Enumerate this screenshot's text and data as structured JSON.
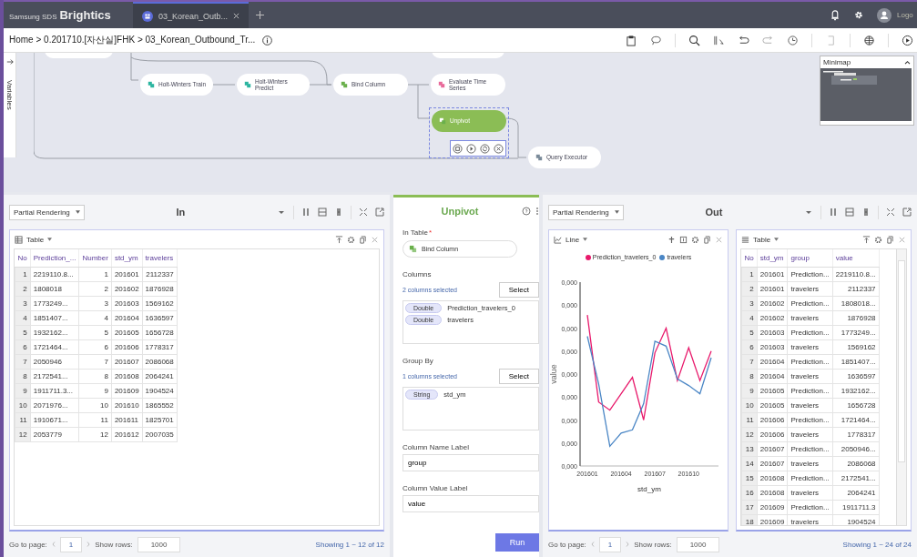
{
  "app": {
    "brand_prefix": "Samsung SDS",
    "brand": "Brightics",
    "tabs": [
      {
        "label": "03_Korean_Outb...",
        "selected": true
      }
    ],
    "user": "Logo"
  },
  "breadcrumb": "Home > 0.201710.[자산실]FHK > 03_Korean_Outbound_Tr...",
  "sidebar": {
    "label": "Variables"
  },
  "canvas": {
    "nodes": [
      {
        "label": "Holt-Winters Train",
        "kind": "model",
        "selected": false
      },
      {
        "label": "Holt-Winters Predict",
        "kind": "model",
        "selected": false
      },
      {
        "label": "Bind Column",
        "kind": "transform",
        "selected": false
      },
      {
        "label": "Evaluate Time Series",
        "kind": "evaluate",
        "selected": false
      },
      {
        "label": "Unpivot",
        "kind": "transform",
        "selected": true
      },
      {
        "label": "Query Executor",
        "kind": "script",
        "selected": false
      }
    ],
    "minimap": {
      "title": "Minimap"
    }
  },
  "input_panel": {
    "render_mode": "Partial Rendering",
    "title": "In",
    "table": {
      "title": "Table",
      "columns": [
        {
          "label": "No"
        },
        {
          "label": "Prediction_..."
        },
        {
          "label": "Number"
        },
        {
          "label": "std_ym"
        },
        {
          "label": "travelers"
        }
      ],
      "rows": [
        [
          "1",
          "2219110.8...",
          "1",
          "201601",
          "2112337"
        ],
        [
          "2",
          "1808018",
          "2",
          "201602",
          "1876928"
        ],
        [
          "3",
          "1773249...",
          "3",
          "201603",
          "1569162"
        ],
        [
          "4",
          "1851407...",
          "4",
          "201604",
          "1636597"
        ],
        [
          "5",
          "1932162...",
          "5",
          "201605",
          "1656728"
        ],
        [
          "6",
          "1721464...",
          "6",
          "201606",
          "1778317"
        ],
        [
          "7",
          "2050946",
          "7",
          "201607",
          "2086068"
        ],
        [
          "8",
          "2172541...",
          "8",
          "201608",
          "2064241"
        ],
        [
          "9",
          "1911711.3...",
          "9",
          "201609",
          "1904524"
        ],
        [
          "10",
          "2071976...",
          "10",
          "201610",
          "1865552"
        ],
        [
          "11",
          "1910671...",
          "11",
          "201611",
          "1825701"
        ],
        [
          "12",
          "2053779",
          "12",
          "201612",
          "2007035"
        ]
      ]
    },
    "footer": {
      "goto_label": "Go to page:",
      "page": "1",
      "rows_label": "Show rows:",
      "rows": "1000",
      "showing": "Showing 1 ~ 12 of 12"
    }
  },
  "editor": {
    "title": "Unpivot",
    "in_table": {
      "label": "In Table",
      "required_mark": "*",
      "value": "Bind Column"
    },
    "columns": {
      "label": "Columns",
      "count": "2 columns selected",
      "button": "Select",
      "items": [
        {
          "type": "Double",
          "name": "Prediction_travelers_0"
        },
        {
          "type": "Double",
          "name": "travelers"
        }
      ]
    },
    "group_by": {
      "label": "Group By",
      "count": "1 columns selected",
      "button": "Select",
      "items": [
        {
          "type": "String",
          "name": "std_ym"
        }
      ]
    },
    "name_label": {
      "label": "Column Name Label",
      "value": "group"
    },
    "value_label": {
      "label": "Column Value Label",
      "value": "value"
    },
    "run": "Run"
  },
  "output_panel": {
    "render_mode": "Partial Rendering",
    "title": "Out",
    "chart": {
      "title": "Line",
      "legend": [
        {
          "name": "Prediction_travelers_0",
          "color": "#e8196b"
        },
        {
          "name": "travelers",
          "color": "#4a86c5"
        }
      ],
      "x_labels": [
        "201601",
        "201604",
        "201607",
        "201610"
      ],
      "xlabel": "std_ym",
      "ylabel": "value",
      "y_axis_labels": [
        "0,000",
        "0,000",
        "0,000",
        "0,000",
        "0,000",
        "0,000",
        "0,000",
        "0,000",
        "0,000"
      ]
    },
    "table": {
      "title": "Table",
      "columns": [
        {
          "label": "No"
        },
        {
          "label": "std_ym"
        },
        {
          "label": "group"
        },
        {
          "label": "value"
        }
      ],
      "rows": [
        [
          "1",
          "201601",
          "Prediction...",
          "2219110.8..."
        ],
        [
          "2",
          "201601",
          "travelers",
          "2112337"
        ],
        [
          "3",
          "201602",
          "Prediction...",
          "1808018..."
        ],
        [
          "4",
          "201602",
          "travelers",
          "1876928"
        ],
        [
          "5",
          "201603",
          "Prediction...",
          "1773249..."
        ],
        [
          "6",
          "201603",
          "travelers",
          "1569162"
        ],
        [
          "7",
          "201604",
          "Prediction...",
          "1851407..."
        ],
        [
          "8",
          "201604",
          "travelers",
          "1636597"
        ],
        [
          "9",
          "201605",
          "Prediction...",
          "1932162..."
        ],
        [
          "10",
          "201605",
          "travelers",
          "1656728"
        ],
        [
          "11",
          "201606",
          "Prediction...",
          "1721464..."
        ],
        [
          "12",
          "201606",
          "travelers",
          "1778317"
        ],
        [
          "13",
          "201607",
          "Prediction...",
          "2050946..."
        ],
        [
          "14",
          "201607",
          "travelers",
          "2086068"
        ],
        [
          "15",
          "201608",
          "Prediction...",
          "2172541..."
        ],
        [
          "16",
          "201608",
          "travelers",
          "2064241"
        ],
        [
          "17",
          "201609",
          "Prediction...",
          "1911711.3"
        ],
        [
          "18",
          "201609",
          "travelers",
          "1904524"
        ]
      ]
    },
    "footer": {
      "goto_label": "Go to page:",
      "page": "1",
      "rows_label": "Show rows:",
      "rows": "1000",
      "showing": "Showing 1 ~ 24 of 24"
    }
  }
}
